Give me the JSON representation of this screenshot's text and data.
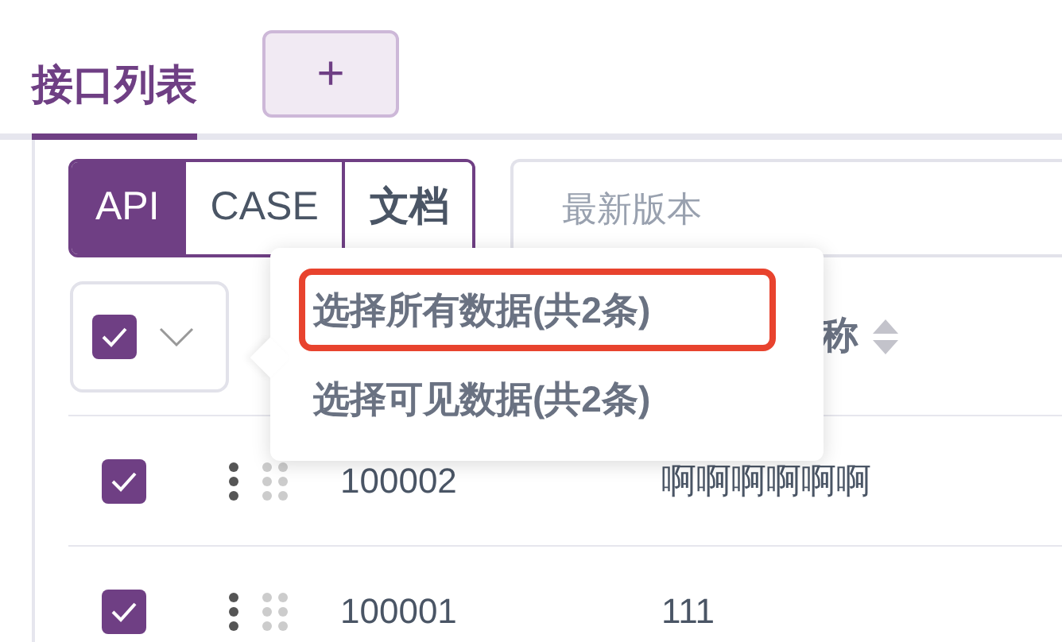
{
  "tabs": [
    {
      "label": "接口列表",
      "selected": true
    }
  ],
  "add_tab_button": {
    "label": "+"
  },
  "type_switch": [
    {
      "label": "API",
      "selected": true
    },
    {
      "label": "CASE",
      "selected": false
    },
    {
      "label": "文档",
      "selected": false
    }
  ],
  "version_select": {
    "placeholder": "最新版本"
  },
  "table": {
    "select_all": {
      "checked": true
    },
    "columns": [
      {
        "label": "称",
        "sortable": true
      }
    ],
    "rows": [
      {
        "checked": true,
        "id": "100002",
        "name": "啊啊啊啊啊啊"
      },
      {
        "checked": true,
        "id": "100001",
        "name": "111"
      }
    ]
  },
  "selection_menu": {
    "items": [
      {
        "label": "选择所有数据(共2条)",
        "highlighted": true
      },
      {
        "label": "选择可见数据(共2条)",
        "highlighted": false
      }
    ]
  }
}
